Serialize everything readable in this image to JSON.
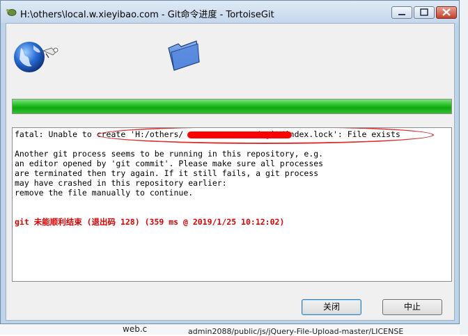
{
  "window": {
    "title": "H:\\others\\local.w.xieyibao.com - Git命令进度 - TortoiseGit"
  },
  "progress": {
    "value": 1.0
  },
  "log": {
    "line1_pre": "fatal: Unable to create 'H:/others/",
    "line1_post": "               /.git/index.lock': File exists",
    "lines": [
      "Another git process seems to be running in this repository, e.g.",
      "an editor opened by 'git commit'. Please make sure all processes",
      "are terminated then try again. If it still fails, a git process",
      "may have crashed in this repository earlier:",
      "remove the file manually to continue."
    ],
    "error": "git 未能顺利结束 (退出码 128) (359 ms @ 2019/1/25 10:12:02)"
  },
  "buttons": {
    "close_label": "关闭",
    "abort_label": "中止"
  },
  "background": {
    "item1": "web.c",
    "item2": "admin2088/public/js/jQuery-File-Upload-master/LICENSE"
  }
}
